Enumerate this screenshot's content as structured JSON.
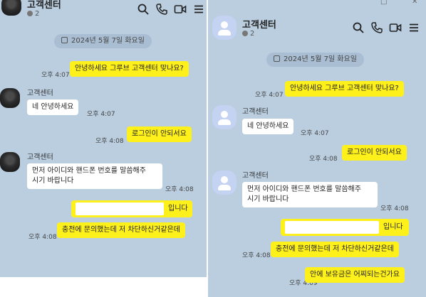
{
  "room": {
    "title": "고객센터",
    "members": "2"
  },
  "date": "2024년 5월 7일 화요일",
  "colors": {
    "chat_bg": "#bacee0",
    "my_bubble": "#fef01b",
    "other_bubble": "#ffffff"
  },
  "icons": [
    "search-icon",
    "phone-icon",
    "video-icon",
    "menu-icon"
  ],
  "left": {
    "messages": [
      {
        "side": "me",
        "text": "안녕하세요 그루브 고객센터 맞나요?",
        "time": "오후 4:07"
      },
      {
        "side": "other",
        "sender": "고객센터",
        "text": "네 안녕하세요",
        "time": "오후 4:07"
      },
      {
        "side": "me",
        "text": "로그인이 안되서요",
        "time": "오후 4:08"
      },
      {
        "side": "other",
        "sender": "고객센터",
        "line1": "먼저 아이디와 핸드폰 번호를 말씀해주",
        "line2": "시기 바랍니다",
        "time": "오후 4:08"
      },
      {
        "side": "me",
        "text": "입니다",
        "time": ""
      },
      {
        "side": "me",
        "text": "충전에 문의했는데 저 차단하신거같은데",
        "time": "오후 4:08"
      }
    ]
  },
  "right": {
    "window_controls": [
      "□",
      "✕"
    ],
    "messages": [
      {
        "side": "me",
        "text": "안녕하세요 그루브 고객센터 맞나요?",
        "time": "오후 4:07"
      },
      {
        "side": "other",
        "sender": "고객센터",
        "text": "네 안녕하세요",
        "time": "오후 4:07"
      },
      {
        "side": "me",
        "text": "로그인이 안되서요",
        "time": "오후 4:08"
      },
      {
        "side": "other",
        "sender": "고객센터",
        "line1": "먼저 아이디와 핸드폰 번호를 말씀해주",
        "line2": "시기 바랍니다",
        "time": "오후 4:08"
      },
      {
        "side": "me",
        "text": "입니다",
        "time": ""
      },
      {
        "side": "me",
        "text": "충전에 문의했는데 저 차단하신거같은데",
        "time": "오후 4:08"
      },
      {
        "side": "me",
        "text": "안에 보유금은 어찌되는건가요",
        "time": "오후 4:09"
      }
    ]
  }
}
